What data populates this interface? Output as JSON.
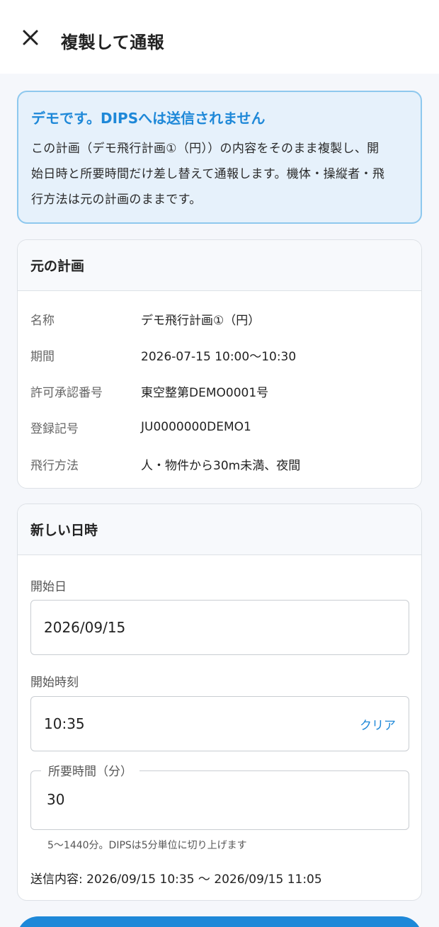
{
  "appbar": {
    "title": "複製して通報",
    "close_icon": "close-icon"
  },
  "demo_banner": {
    "title": "デモです。DIPSへは送信されません",
    "body_lines": [
      "この計画（デモ飛行計画①（円））の内容をそのまま複製し、開",
      "始日時と所要時間だけ差し替えて通報します。機体・操縦者・飛",
      "行方法は元の計画のままです。"
    ]
  },
  "original_plan": {
    "header": "元の計画",
    "rows": [
      {
        "label": "名称",
        "value": "デモ飛行計画①（円）"
      },
      {
        "label": "期間",
        "value": "2026-07-15 10:00〜10:30"
      },
      {
        "label": "許可承認番号",
        "value": "東空整第DEMO0001号"
      },
      {
        "label": "登録記号",
        "value": "JU0000000DEMO1"
      },
      {
        "label": "飛行方法",
        "value": "人・物件から30m未満、夜間"
      }
    ]
  },
  "new_datetime": {
    "header": "新しい日時",
    "start_date_label": "開始日",
    "start_date_value": "2026/09/15",
    "start_time_label": "開始時刻",
    "start_time_value": "10:35",
    "clear_label": "クリア",
    "duration_label": "所要時間（分）",
    "duration_value": "30",
    "duration_helper": "5〜1440分。DIPSは5分単位に切り上げます",
    "summary": "送信内容: 2026/09/15 10:35 〜 2026/09/15 11:05"
  },
  "colors": {
    "accent": "#1e88d8",
    "banner_bg": "#e6f1fb",
    "banner_border": "#8ec8ee"
  }
}
